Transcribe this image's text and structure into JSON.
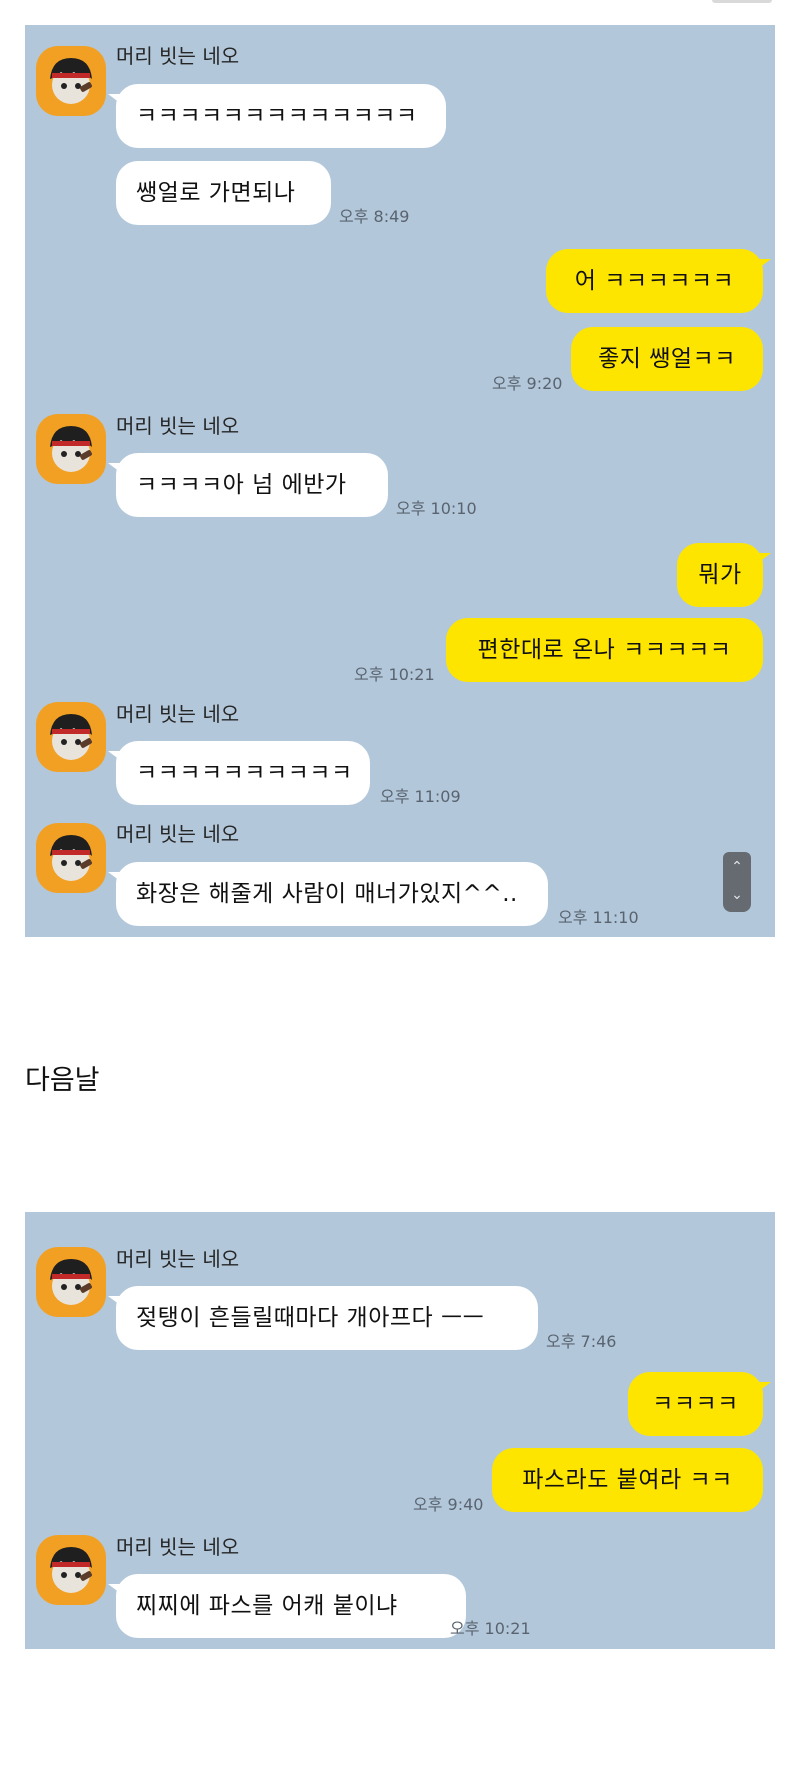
{
  "sender_name": "머리 빗는 네오",
  "day_divider": "다음날",
  "colors": {
    "chat_background": "#b2c7da",
    "outgoing_bubble": "#fee500",
    "incoming_bubble": "#ffffff",
    "avatar_background": "#f2a023"
  },
  "icons": {
    "avatar": "neo-character-avatar-icon",
    "scroll_up": "chevron-up-icon",
    "scroll_down": "chevron-down-icon"
  },
  "chat1": {
    "messages": [
      {
        "from": "them",
        "text": "ㅋㅋㅋㅋㅋㅋㅋㅋㅋㅋㅋㅋㅋ"
      },
      {
        "from": "them",
        "text": "쌩얼로 가면되나",
        "time": "오후 8:49"
      },
      {
        "from": "me",
        "text": "어 ㅋㅋㅋㅋㅋㅋ"
      },
      {
        "from": "me",
        "text": "좋지 쌩얼ㅋㅋ",
        "time": "오후 9:20"
      },
      {
        "from": "them",
        "text": "ㅋㅋㅋㅋ아 넘 에반가",
        "time": "오후 10:10"
      },
      {
        "from": "me",
        "text": "뭐가"
      },
      {
        "from": "me",
        "text": "편한대로 온나 ㅋㅋㅋㅋㅋ",
        "time": "오후 10:21"
      },
      {
        "from": "them",
        "text": "ㅋㅋㅋㅋㅋㅋㅋㅋㅋㅋ",
        "time": "오후 11:09"
      },
      {
        "from": "them",
        "text": "화장은 해줄게 사람이 매너가있지^^..",
        "time": "오후 11:10"
      }
    ]
  },
  "chat2": {
    "messages": [
      {
        "from": "them",
        "text": "젖탱이 흔들릴때마다 개아프다 ㅡㅡ",
        "time": "오후 7:46"
      },
      {
        "from": "me",
        "text": "ㅋㅋㅋㅋ"
      },
      {
        "from": "me",
        "text": "파스라도 붙여라 ㅋㅋ",
        "time": "오후 9:40"
      },
      {
        "from": "them",
        "text": "찌찌에 파스를 어캐 붙이냐",
        "time": "오후 10:21"
      }
    ]
  }
}
